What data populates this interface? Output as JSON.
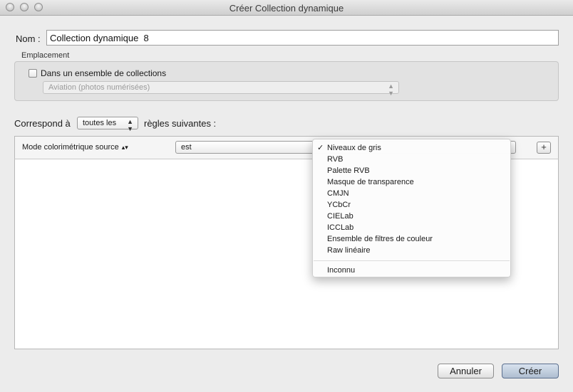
{
  "window": {
    "title": "Créer Collection dynamique"
  },
  "name": {
    "label": "Nom :",
    "value": "Collection dynamique  8"
  },
  "location": {
    "group_title": "Emplacement",
    "checkbox_label": "Dans un ensemble de collections",
    "checkbox_checked": false,
    "set_select_value": "Aviation (photos numérisées)"
  },
  "match": {
    "prefix": "Correspond à",
    "select_value": "toutes les",
    "suffix": "règles suivantes :"
  },
  "rule": {
    "field": "Mode colorimétrique source",
    "operator": "est",
    "add_label": "+"
  },
  "menu": {
    "items": [
      "Niveaux de gris",
      "RVB",
      "Palette RVB",
      "Masque de transparence",
      "CMJN",
      "YCbCr",
      "CIELab",
      "ICCLab",
      "Ensemble de filtres de couleur",
      "Raw linéaire"
    ],
    "checked_item": "Niveaux de gris",
    "extra_item": "Inconnu"
  },
  "buttons": {
    "cancel": "Annuler",
    "create": "Créer"
  },
  "icons": {
    "checkmark": "✓",
    "updown": "⇕"
  }
}
